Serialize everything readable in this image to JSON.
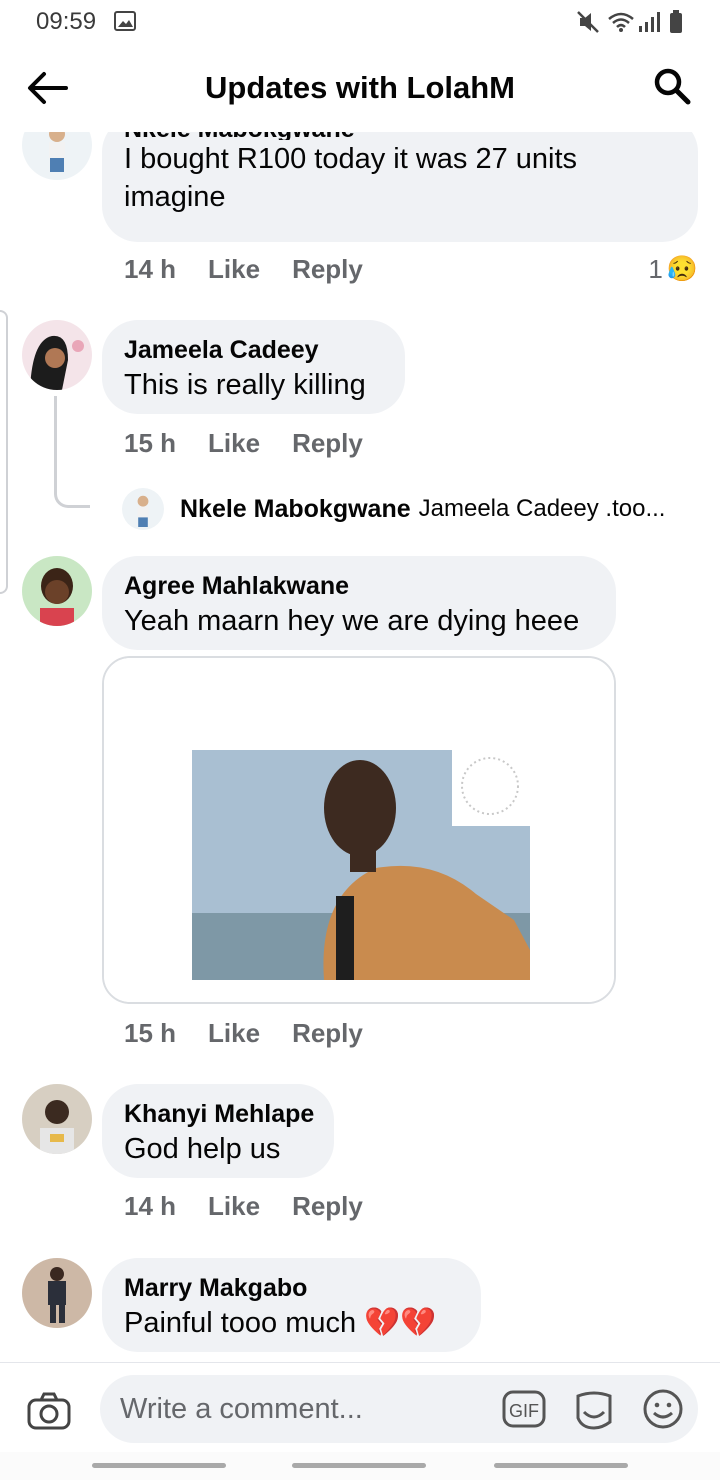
{
  "status_bar": {
    "time": "09:59"
  },
  "header": {
    "title": "Updates with LolahM"
  },
  "comments": [
    {
      "author": "Nkele Mabokgwane",
      "text": "I bought R100 today it was 27 units imagine",
      "time": "14 h",
      "like": "Like",
      "reply": "Reply",
      "reaction_count": "1",
      "reaction_emoji": "😥"
    },
    {
      "author": "Jameela Cadeey",
      "text": "This is really killing",
      "time": "15 h",
      "like": "Like",
      "reply": "Reply"
    },
    {
      "author": "Agree Mahlakwane",
      "text": "Yeah maarn hey we are dying heee",
      "time": "15 h",
      "like": "Like",
      "reply": "Reply"
    },
    {
      "author": "Khanyi Mehlape",
      "text": "God help us",
      "time": "14 h",
      "like": "Like",
      "reply": "Reply"
    },
    {
      "author": "Marry Makgabo",
      "text": "Painful tooo much 💔💔",
      "time": "",
      "like": "",
      "reply": ""
    }
  ],
  "reply_preview": {
    "author": "Nkele Mabokgwane",
    "snippet": "Jameela Cadeey .too..."
  },
  "composer": {
    "placeholder": "Write a comment...",
    "gif_label": "GIF"
  },
  "colors": {
    "bubble": "#f0f2f5",
    "meta_text": "#65676b",
    "text": "#050505",
    "divider": "#dadde1"
  }
}
